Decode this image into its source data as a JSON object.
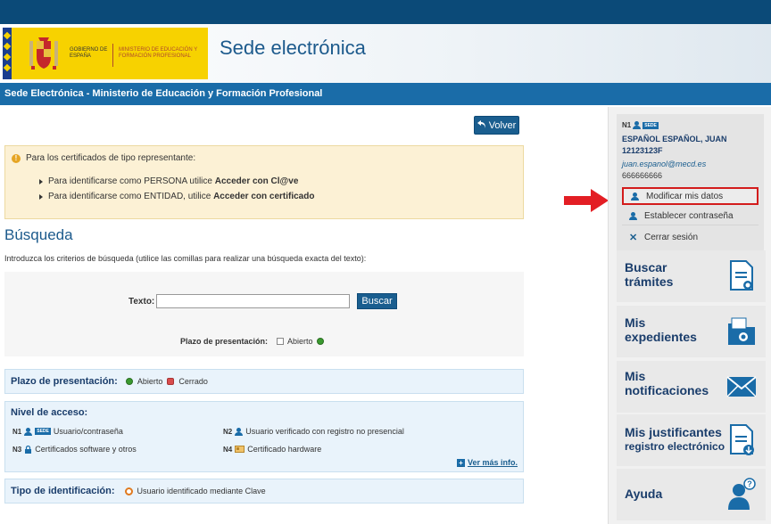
{
  "header": {
    "gobierno": "GOBIERNO DE ESPAÑA",
    "ministerio": "MINISTERIO DE EDUCACIÓN Y FORMACIÓN PROFESIONAL",
    "site_title": "Sede electrónica"
  },
  "bluebar": {
    "title": "Sede Electrónica - Ministerio de Educación y Formación Profesional"
  },
  "volver_label": "Volver",
  "notice": {
    "intro": "Para los certificados de tipo representante:",
    "b1_pre": "Para identificarse como PERSONA utilice ",
    "b1_strong": "Acceder con Cl@ve",
    "b2_pre": "Para identificarse como ENTIDAD, utilice ",
    "b2_strong": "Acceder con certificado"
  },
  "busqueda": {
    "title": "Búsqueda",
    "intro": "Introduzca los criterios de búsqueda (utilice las comillas para realizar una búsqueda exacta del texto):",
    "texto_label": "Texto:",
    "texto_value": "",
    "buscar_label": "Buscar",
    "plazo_label": "Plazo de presentación:",
    "abierto_label": "Abierto"
  },
  "legend_plazo": {
    "title": "Plazo de presentación:",
    "abierto": "Abierto",
    "cerrado": "Cerrado"
  },
  "legend_nivel": {
    "title": "Nivel de acceso:",
    "items": [
      {
        "code": "N1",
        "badge": "SEDE",
        "label": "Usuario/contraseña"
      },
      {
        "code": "N2",
        "label": "Usuario verificado con registro no presencial"
      },
      {
        "code": "N3",
        "label": "Certificados software y otros"
      },
      {
        "code": "N4",
        "label": "Certificado hardware"
      }
    ],
    "ver_mas": "Ver más info."
  },
  "legend_tipo": {
    "title": "Tipo de identificación:",
    "value": "Usuario identificado mediante Clave"
  },
  "user": {
    "level": "N1",
    "badge": "SEDE",
    "name": "ESPAÑOL ESPAÑOL, JUAN",
    "nif": "12123123F",
    "email": "juan.espanol@mecd.es",
    "phone": "666666666",
    "menu": [
      {
        "label": "Modificar mis datos",
        "icon": "user-edit-icon",
        "highlighted": true
      },
      {
        "label": "Establecer contraseña",
        "icon": "user-key-icon",
        "highlighted": false
      },
      {
        "label": "Cerrar sesión",
        "icon": "close-icon",
        "highlighted": false
      }
    ]
  },
  "tiles": [
    {
      "line1": "Buscar",
      "line2": "trámites",
      "icon": "document-search-icon"
    },
    {
      "line1": "Mis",
      "line2": "expedientes",
      "icon": "folder-search-icon"
    },
    {
      "line1": "Mis",
      "line2": "notificaciones",
      "icon": "envelope-icon"
    },
    {
      "line1": "Mis justificantes",
      "line2": "registro electrónico",
      "icon": "document-download-icon"
    },
    {
      "line1": "Ayuda",
      "line2": "",
      "icon": "help-user-icon"
    }
  ],
  "colors": {
    "brand_blue": "#1a6ca8",
    "dark_blue": "#0b4a78",
    "highlight_red": "#d31c1c",
    "notice_bg": "#fcf1d5"
  }
}
